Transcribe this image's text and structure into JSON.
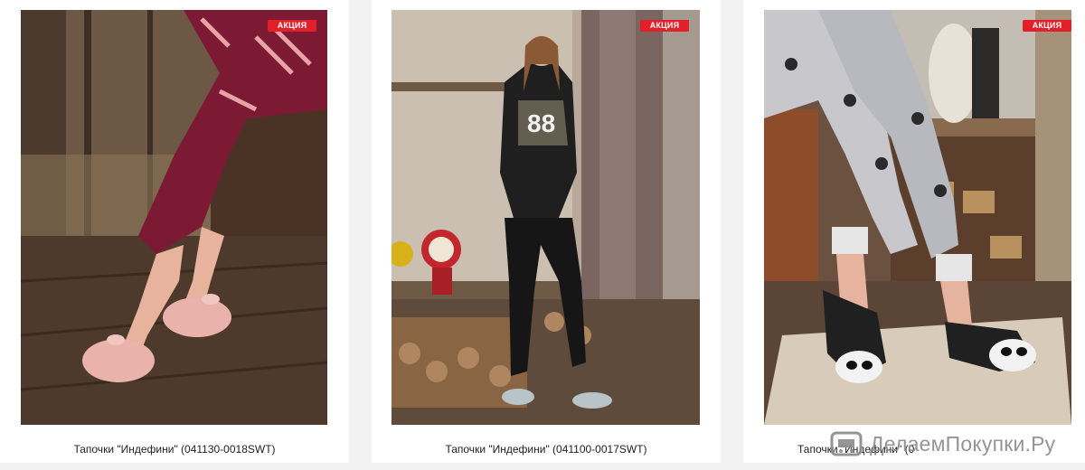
{
  "products": [
    {
      "badge": "АКЦИЯ",
      "title": "Тапочки \"Индефини\" (041130-0018SWT)"
    },
    {
      "badge": "АКЦИЯ",
      "title": "Тапочки \"Индефини\" (041100-0017SWT)"
    },
    {
      "badge": "АКЦИЯ",
      "title": "Тапочки \"Индефини\" (041130-0016SWT)"
    }
  ],
  "watermark": {
    "text": "ДелаемПокупки.Ру"
  },
  "colors": {
    "badge": "#e3202a",
    "background": "#f2f2f2",
    "card": "#ffffff"
  },
  "icons": [
    "cart-logo-icon"
  ]
}
